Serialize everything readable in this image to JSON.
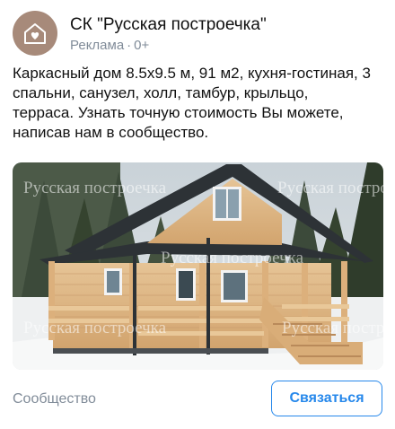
{
  "post": {
    "author": "СК \"Русская построечка\"",
    "label": "Реклама",
    "age_rating": "0+",
    "text": "Каркасный дом 8.5х9.5 м, 91 м2, кухня-гостиная, 3 спальни, санузел, холл, тамбур, крыльцо, терраса. Узнать точную стоимость Вы можете, написав нам в сообщество.",
    "image_watermark": "Русская построечка",
    "source_label": "Сообщество",
    "cta_label": "Связаться"
  },
  "icons": {
    "avatar": "house-heart-logo"
  },
  "colors": {
    "accent": "#2688eb",
    "secondary_text": "#818c99",
    "avatar_bg": "#a78a7a"
  }
}
